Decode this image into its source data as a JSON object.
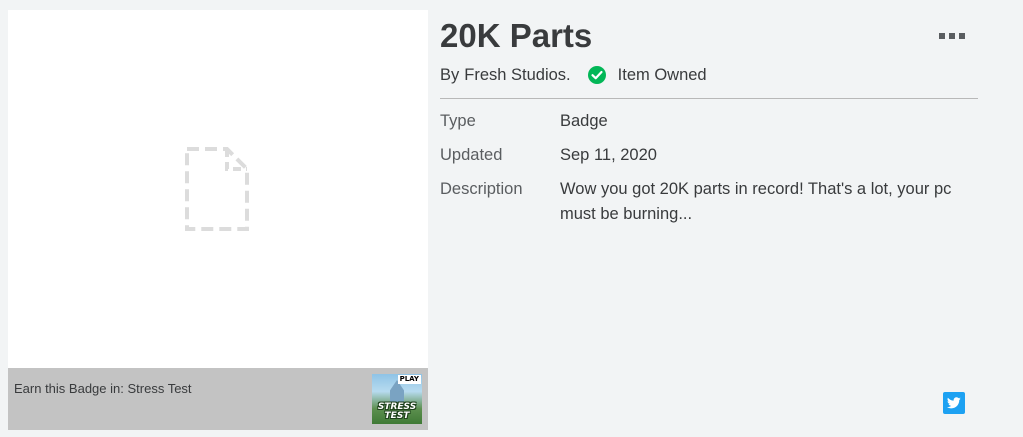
{
  "item": {
    "title": "20K Parts",
    "by_prefix": "By",
    "creator": "Fresh Studios.",
    "owned_label": "Item Owned"
  },
  "details": {
    "type_label": "Type",
    "type_value": "Badge",
    "updated_label": "Updated",
    "updated_value": "Sep 11, 2020",
    "description_label": "Description",
    "description_value": "Wow you got 20K parts in record! That's a lot, your pc must be burning..."
  },
  "earn": {
    "prefix": "Earn this Badge in:",
    "game_name": "Stress Test",
    "thumb_tag": "PLAY",
    "thumb_title_1": "STRESS",
    "thumb_title_2": "TEST"
  },
  "icons": {
    "placeholder": "file-placeholder-icon",
    "owned": "check-circle-icon",
    "more": "more-options-icon",
    "share": "twitter-icon"
  },
  "colors": {
    "owned_green": "#02b757",
    "twitter_blue": "#1da1f2",
    "earn_bar": "#c3c3c3"
  }
}
